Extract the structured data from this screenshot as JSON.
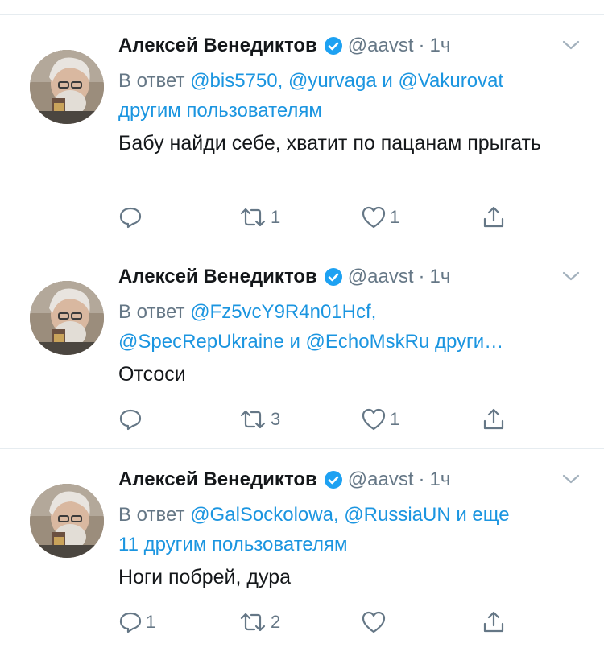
{
  "tweets": [
    {
      "author": "Алексей Венедиктов",
      "handle": "@aavst",
      "separator": "·",
      "time": "1ч",
      "reply_prefix": "В ответ",
      "reply_line1_links": "@bis5750, @yurvaga",
      "reply_and": "и",
      "reply_line1_link2": "@Vakurovat",
      "reply_line2": "другим пользователям",
      "text": "Бабу найди себе, хватит по пацанам прыгать",
      "reply_count": "",
      "retweet_count": "1",
      "like_count": "1"
    },
    {
      "author": "Алексей Венедиктов",
      "handle": "@aavst",
      "separator": "·",
      "time": "1ч",
      "reply_prefix": "В ответ",
      "reply_line1_links": "@Fz5vcY9R4n01Hcf,",
      "reply_line2_link": "@SpecRepUkraine",
      "reply_and": "и",
      "reply_line2_link2": "@EchoMskRu",
      "reply_line2_tail": "други…",
      "text": "Отсоси",
      "reply_count": "",
      "retweet_count": "3",
      "like_count": "1"
    },
    {
      "author": "Алексей Венедиктов",
      "handle": "@aavst",
      "separator": "·",
      "time": "1ч",
      "reply_prefix": "В ответ",
      "reply_line1_links": "@GalSockolowa, @RussiaUN",
      "reply_and": "и еще",
      "reply_line2": "11 другим пользователям",
      "text": "Ноги побрей, дура",
      "reply_count": "1",
      "retweet_count": "2",
      "like_count": ""
    }
  ],
  "icons": {
    "verified": "verified-badge-icon",
    "chevron": "chevron-down-icon",
    "reply": "reply-icon",
    "retweet": "retweet-icon",
    "like": "heart-icon",
    "share": "share-icon"
  },
  "colors": {
    "text": "#14171a",
    "secondary": "#657786",
    "link": "#1b95e0",
    "verified": "#1da1f2",
    "divider": "#e6ecf0"
  }
}
